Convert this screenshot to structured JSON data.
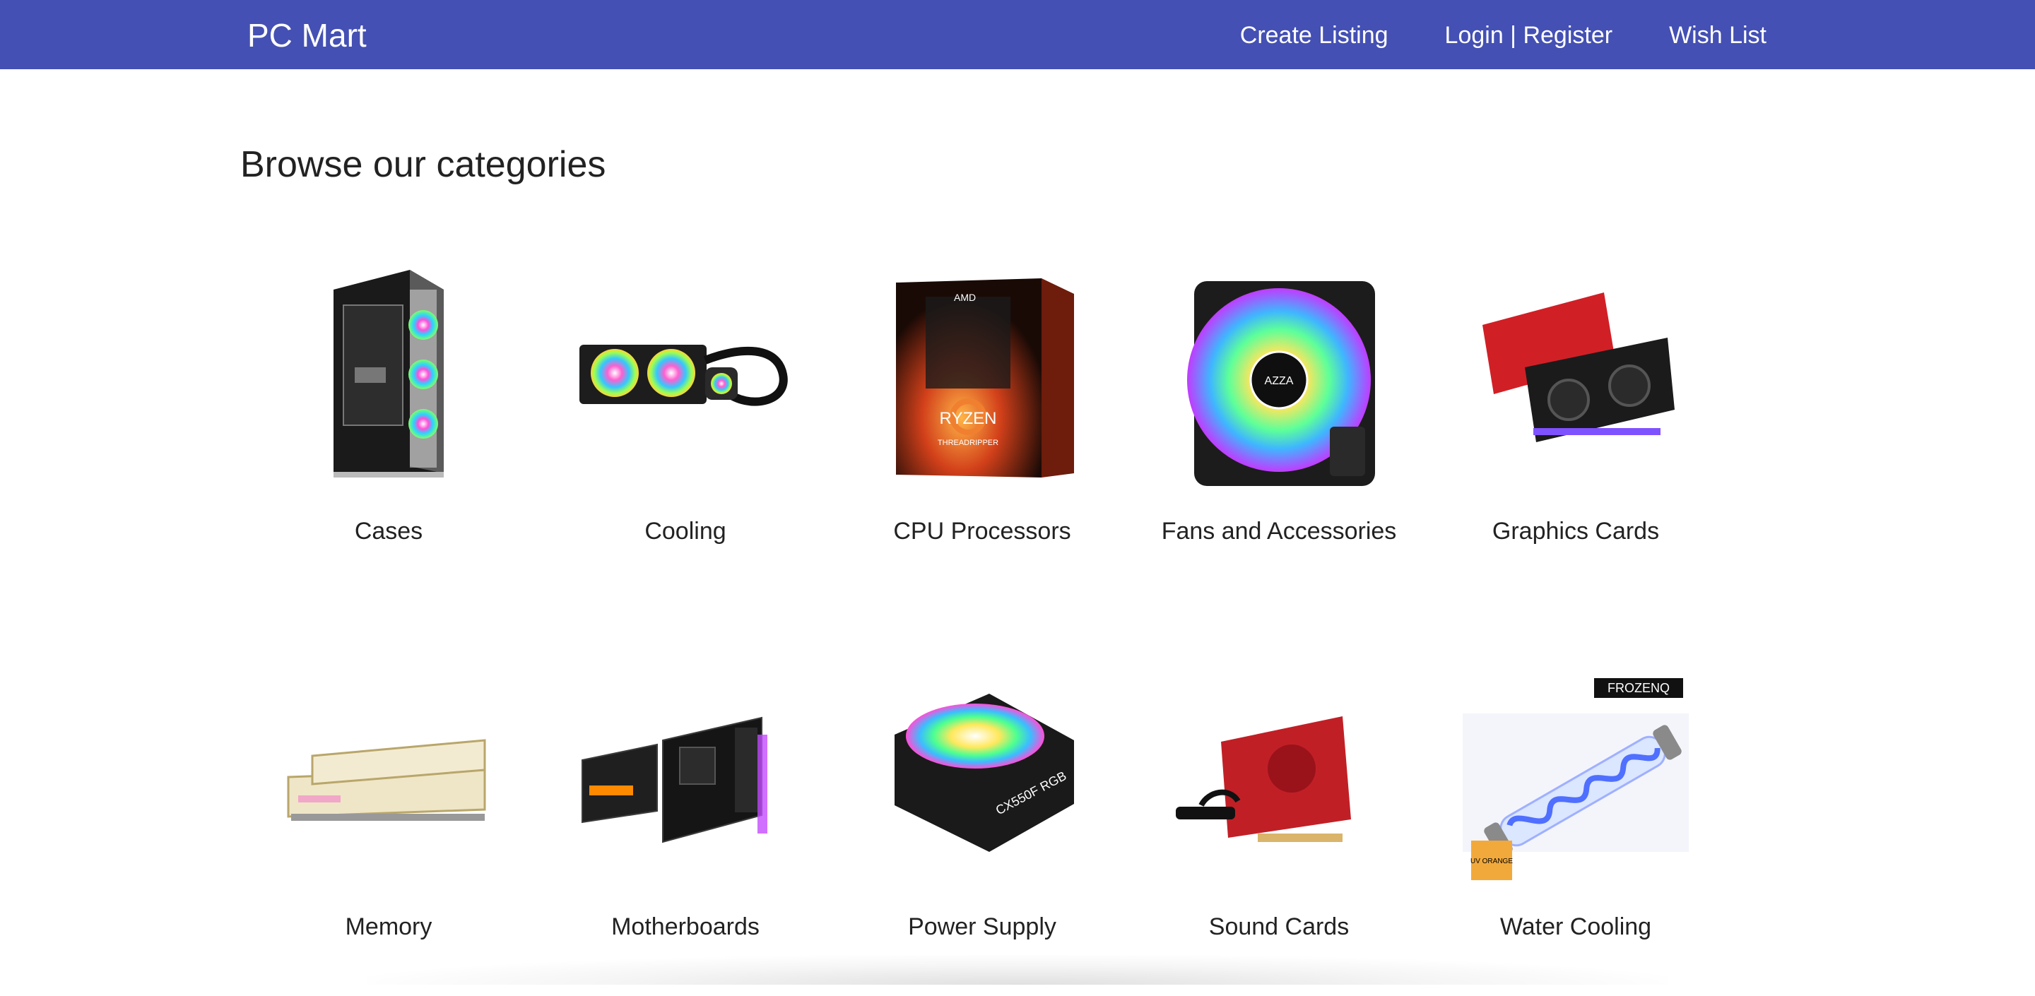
{
  "navbar": {
    "brand": "PC Mart",
    "links": [
      {
        "label": "Create Listing"
      },
      {
        "label": "Login | Register"
      },
      {
        "label": "Wish List"
      }
    ],
    "bg_color": "#4450b3"
  },
  "main": {
    "title": "Browse our categories",
    "categories": [
      {
        "label": "Cases",
        "icon": "pc-case-image"
      },
      {
        "label": "Cooling",
        "icon": "aio-cooler-image"
      },
      {
        "label": "CPU Processors",
        "icon": "cpu-box-image",
        "box_brand": "AMD",
        "box_product": "RYZEN",
        "box_line": "THREADRIPPER"
      },
      {
        "label": "Fans and Accessories",
        "icon": "rgb-fan-image",
        "fan_brand": "AZZA"
      },
      {
        "label": "Graphics Cards",
        "icon": "graphics-card-image"
      },
      {
        "label": "Memory",
        "icon": "ram-modules-image"
      },
      {
        "label": "Motherboards",
        "icon": "motherboard-image"
      },
      {
        "label": "Power Supply",
        "icon": "power-supply-image",
        "psu_model": "CX550F RGB"
      },
      {
        "label": "Sound Cards",
        "icon": "sound-card-image"
      },
      {
        "label": "Water Cooling",
        "icon": "water-cooling-tube-image",
        "brand_badge": "FROZENQ",
        "corner_tag": "UV ORANGE"
      }
    ]
  }
}
